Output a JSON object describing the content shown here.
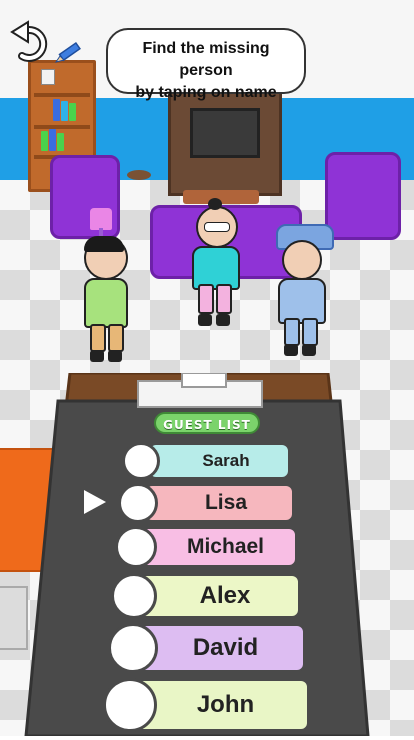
{
  "instruction": {
    "line1": "Find the missing person",
    "line2": "by taping on name"
  },
  "icons": {
    "undo": "undo-icon",
    "pencil": "pencil-icon"
  },
  "guest_list": {
    "title": "GUEST LIST",
    "selected_index": 1,
    "names": [
      {
        "label": "Sarah",
        "color": "#b7ece9"
      },
      {
        "label": "Lisa",
        "color": "#f6b7be"
      },
      {
        "label": "Michael",
        "color": "#f8bee4"
      },
      {
        "label": "Alex",
        "color": "#ecf7c7"
      },
      {
        "label": "David",
        "color": "#ddbdf2"
      },
      {
        "label": "John",
        "color": "#e9f6c6"
      }
    ]
  },
  "colors": {
    "wall_stripe": "#1f9fe6",
    "sofa": "#8f33d6",
    "board": "#4a4a4a"
  }
}
